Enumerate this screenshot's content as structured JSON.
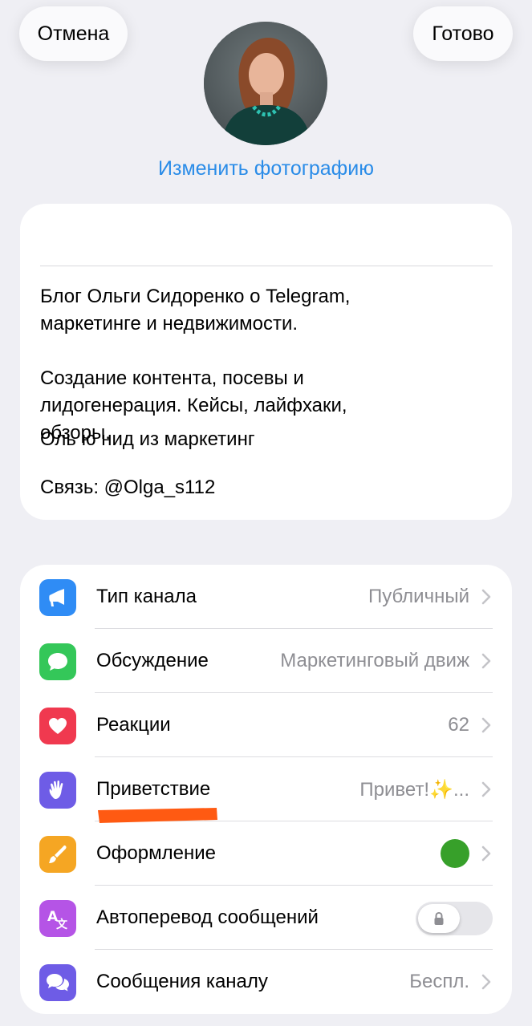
{
  "header": {
    "cancel_label": "Отмена",
    "done_label": "Готово",
    "change_photo_label": "Изменить фотографию"
  },
  "info": {
    "name": "Оль ю нид из маркетинг",
    "bio": "Блог Ольги Сидоренко о Telegram,\nмаркетинге и недвижимости.\n\nСоздание контента, посевы и\nлидогенерация. Кейсы, лайфхаки,\nобзоры.\n\nСвязь: @Olga_s112"
  },
  "settings": {
    "items": [
      {
        "label": "Тип канала",
        "value": "Публичный",
        "icon": "megaphone-icon",
        "color": "#2f8cf5"
      },
      {
        "label": "Обсуждение",
        "value": "Маркетинговый движ",
        "icon": "chat-bubble-icon",
        "color": "#34c759"
      },
      {
        "label": "Реакции",
        "value": "62",
        "icon": "heart-icon",
        "color": "#f0394f"
      },
      {
        "label": "Приветствие",
        "value": "Привет!✨...",
        "icon": "waving-hand-icon",
        "color": "#6e5ce6"
      },
      {
        "label": "Оформление",
        "value": "",
        "icon": "brush-icon",
        "color": "#f5a623"
      },
      {
        "label": "Автоперевод сообщений",
        "value": "",
        "icon": "translate-icon",
        "color": "#b554e6",
        "toggle": false
      },
      {
        "label": "Сообщения каналу",
        "value": "Беспл.",
        "icon": "chat-bubbles-icon",
        "color": "#6e5ce6"
      }
    ],
    "appearance_color": "#37a02a"
  },
  "accent": "#2a8ce8"
}
